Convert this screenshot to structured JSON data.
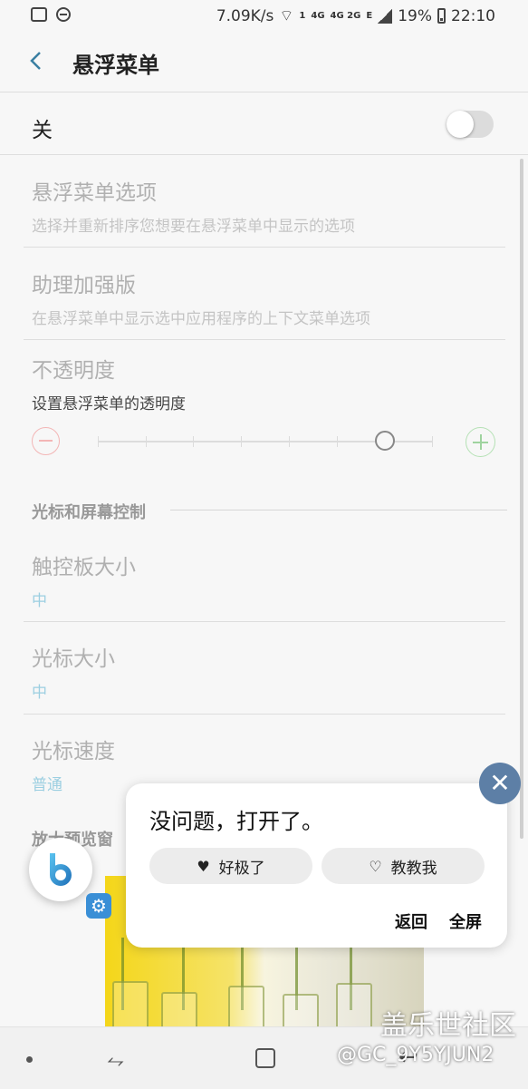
{
  "status_bar": {
    "net_speed": "7.09K/s",
    "sim1": "1",
    "net1": "4G",
    "net2": "4G 2G",
    "net3": "E",
    "battery": "19%",
    "time": "22:10"
  },
  "header": {
    "title": "悬浮菜单",
    "back_icon": "chevron-left-icon"
  },
  "master_toggle": {
    "label": "关",
    "state": "off"
  },
  "items": [
    {
      "title": "悬浮菜单选项",
      "subtitle": "选择并重新排序您想要在悬浮菜单中显示的选项"
    },
    {
      "title": "助理加强版",
      "subtitle": "在悬浮菜单中显示选中应用程序的上下文菜单选项"
    },
    {
      "title": "不透明度",
      "subtitle": "设置悬浮菜单的透明度"
    }
  ],
  "opacity_slider": {
    "level_fraction": 0.86,
    "ticks": 8
  },
  "section_header": "光标和屏幕控制",
  "cursor_items": [
    {
      "title": "触控板大小",
      "value": "中"
    },
    {
      "title": "光标大小",
      "value": "中"
    },
    {
      "title": "光标速度",
      "value": "普通"
    }
  ],
  "preview_label": "放大预览窗",
  "bixby_popup": {
    "message": "没问题，打开了。",
    "great_label": "好极了",
    "teach_label": "教教我",
    "back_label": "返回",
    "fullscreen_label": "全屏"
  },
  "watermark": {
    "line1": "盖乐世社区",
    "line2": "@GC_9Y5YJUN2"
  },
  "colors": {
    "accent": "#3a7fa2",
    "value_blue": "#9ccfe1",
    "close_button": "#5d7fa6"
  }
}
